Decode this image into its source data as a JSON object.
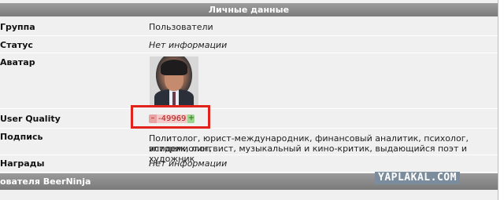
{
  "header": {
    "title": "Личные данные"
  },
  "rows": [
    {
      "label": "Группа",
      "value": "Пользователи"
    },
    {
      "label": "Статус",
      "value": "Нет информации"
    },
    {
      "label": "Аватар"
    },
    {
      "label": "User Quality",
      "minus": "–",
      "rating": "-49969",
      "plus": "+"
    },
    {
      "label": "Подпись",
      "value_line1": "Политолог, юрист-международник, финансовый аналитик, психолог, эпидемиолог,",
      "value_line2": "историк, лингвист, музыкальный и кино-критик, выдающийся поэт и художник"
    },
    {
      "label": "Награды",
      "value": "Нет информации"
    }
  ],
  "footer": {
    "title": "ователя BeerNinja"
  },
  "watermark": "YAPLAKAL.COM",
  "colors": {
    "header_bg": "#8a8a8a",
    "highlight": "#e0231b",
    "rating_neg": "#b01818"
  }
}
